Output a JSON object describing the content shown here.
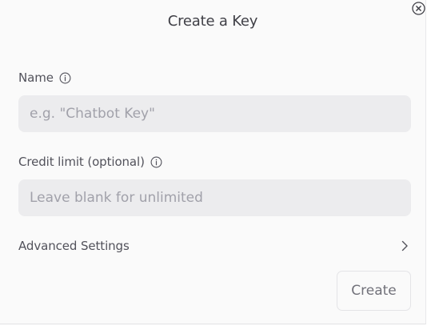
{
  "dialog": {
    "title": "Create a Key",
    "close_icon": "close-circle-icon"
  },
  "name_field": {
    "label": "Name",
    "info_icon": "info-icon",
    "value": "",
    "placeholder": "e.g. \"Chatbot Key\""
  },
  "credit_field": {
    "label": "Credit limit (optional)",
    "info_icon": "info-icon",
    "value": "",
    "placeholder": "Leave blank for unlimited"
  },
  "advanced": {
    "label": "Advanced Settings",
    "icon": "chevron-right-icon"
  },
  "actions": {
    "create_label": "Create"
  },
  "colors": {
    "dialog_background": "#fafafa",
    "input_background": "#ececee",
    "text": "#52525b",
    "placeholder": "#a1a1aa"
  }
}
